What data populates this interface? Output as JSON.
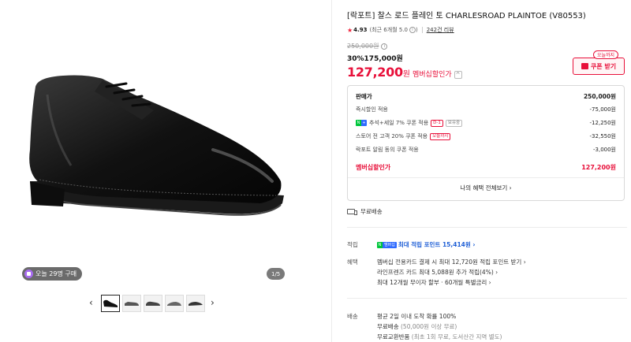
{
  "product": {
    "title": "[락포트] 찰스 로드 플레인 토 CHARLESROAD PLAINTOE (V80553)",
    "rating": "4.93",
    "rating_detail": "(최근 6개월 5.0",
    "reviews": "242건 리뷰",
    "original_price": "250,000원",
    "discount_rate": "30%",
    "sale_price": "175,000원",
    "member_price": "127,200",
    "member_won": "원",
    "member_label": "멤버십할인가",
    "today_tag": "오늘까지",
    "coupon_label": "쿠폰 받기"
  },
  "gallery": {
    "buy_badge": "오늘 29명 구매",
    "counter": "1/5",
    "prev": "‹",
    "next": "›",
    "thumb_count": 5
  },
  "price_breakdown": {
    "rows": [
      {
        "label": "판매가",
        "value": "250,000원"
      },
      {
        "label": "즉시할인 적용",
        "value": "-75,000원"
      },
      {
        "label": "추석+세일 7% 쿠폰 적용",
        "tag": "D-1",
        "tag2": "보유중",
        "value": "-12,250원"
      },
      {
        "label": "스토어 전 고객 20% 쿠폰 적용",
        "tag": "오늘까지",
        "value": "-32,550원"
      },
      {
        "label": "락포트 알림 동의 쿠폰 적용",
        "value": "-3,000원"
      },
      {
        "label": "멤버십할인가",
        "value": "127,200원"
      }
    ],
    "all_benefits": "나의 혜택 전체보기 ›"
  },
  "shipping_free": "무료배송",
  "points": {
    "label": "적립",
    "badge_n": "N",
    "badge_m": "멤버십",
    "text": "최대 적립 포인트 15,414원 ›"
  },
  "benefits": {
    "label": "혜택",
    "lines": [
      "멤버십 전용카드 결제 시 최대 12,720원 적립 포인트 받기 ›",
      "라인프렌즈 카드 최대 5,088원 추가 적립(4%) ›",
      "최대 12개월 무이자 할부 · 60개월 특별금리 ›"
    ]
  },
  "delivery": {
    "label": "배송",
    "line1": "평균 2일 이내 도착 확률 100%",
    "line2a": "무료배송",
    "line2b": "(50,000원 이상 무료)",
    "line3a": "무료교환반품",
    "line3b": "(최초 1회 무료, 도서산간 지역 별도)"
  },
  "colors": {
    "accent": "#e8103a",
    "blue": "#1f5fd6",
    "naver": "#00c73c"
  }
}
